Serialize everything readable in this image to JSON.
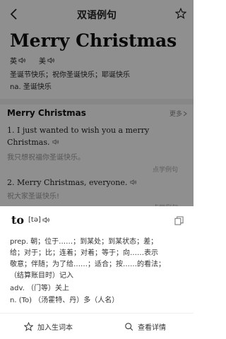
{
  "header": {
    "title": "双语例句"
  },
  "word": {
    "headword": "Merry Christmas",
    "pron_uk": "英",
    "pron_us": "美",
    "translations": [
      "圣诞节快乐；祝你圣诞快乐；耶诞快乐",
      "na. 圣诞快乐"
    ]
  },
  "examples": {
    "heading": "Merry Christmas",
    "more": "更多",
    "items": [
      {
        "en": "1. I just wanted to wish you a merry Christmas.",
        "zh": "我只想祝福你圣诞快乐。",
        "source": "点学例句"
      },
      {
        "en": "2. Merry Christmas, everyone.",
        "zh": "祝大家圣诞快乐!",
        "source": "点学例句"
      }
    ]
  },
  "popup": {
    "word": "to",
    "phonetic": "[tə]",
    "definitions": [
      "prep. 朝；位于……；到某处；到某状态；差；",
      "给；对于；比；连着；对着；等于；向……表示",
      "敬意；伴随；为了给……；适合；按……的看法；",
      "（结算账目时）记入",
      "adv. （门等）关上",
      "n. (To) （汤霍特、丹）多（人名）"
    ],
    "add_label": "加入生词本",
    "detail_label": "查看详情"
  }
}
